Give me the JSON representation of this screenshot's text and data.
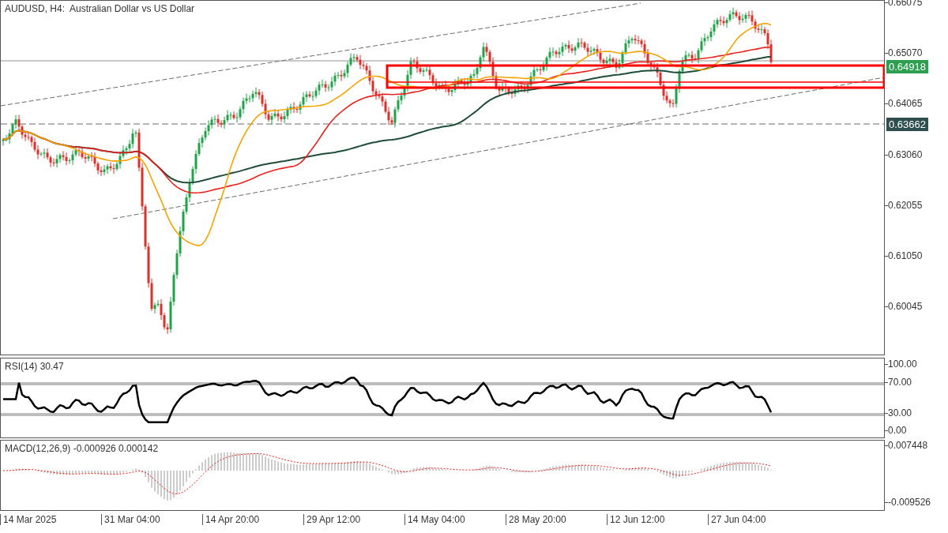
{
  "chart": {
    "title": "AUDUSD, H4:  Australian Dollar vs US Dollar",
    "price_axis": [
      "0.66075",
      "0.65070",
      "0.64065",
      "0.63060",
      "0.62055",
      "0.61050",
      "0.60045"
    ],
    "price_tags": [
      {
        "label": "0.64918",
        "kind": "bid"
      },
      {
        "label": "0.63662",
        "kind": "level"
      }
    ]
  },
  "rsi": {
    "label": "RSI(14) 30.47",
    "axis": [
      "100.00",
      "70.00",
      "30.00",
      "0.00"
    ]
  },
  "macd": {
    "label": "MACD(12,26,9) -0.000926 0.000142",
    "axis": [
      "0.007448",
      "-0.009526"
    ]
  },
  "time_axis": [
    "14 Mar 2025",
    "31 Mar 04:00",
    "14 Apr 20:00",
    "29 Apr 12:00",
    "14 May 04:00",
    "28 May 20:00",
    "12 Jun 12:00",
    "27 Jun 04:00"
  ]
}
